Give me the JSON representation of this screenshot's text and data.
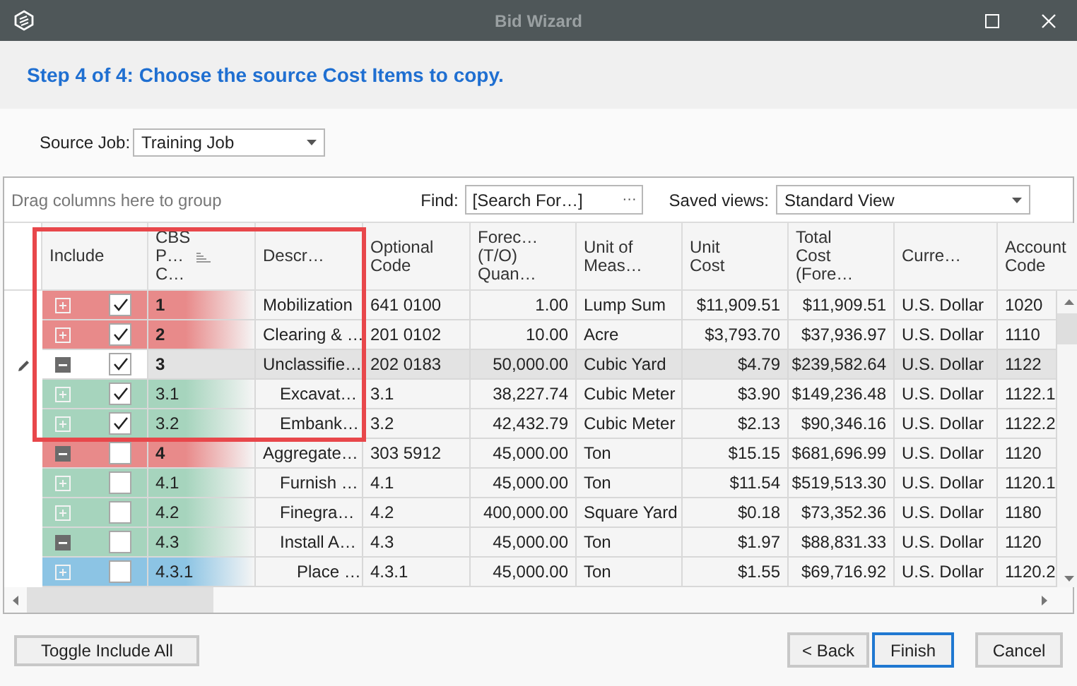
{
  "window": {
    "title": "Bid Wizard"
  },
  "step_title": "Step 4 of 4: Choose the source Cost Items to copy.",
  "source_job": {
    "label": "Source Job:",
    "value": "Training Job"
  },
  "group_panel": {
    "placeholder": "Drag columns here to group"
  },
  "find": {
    "label": "Find:",
    "placeholder": "[Search For…]",
    "button": "···"
  },
  "saved_views": {
    "label": "Saved views:",
    "value": "Standard View"
  },
  "columns": [
    {
      "label": "Include",
      "sorted": false
    },
    {
      "label": "CBS\nP…\nC…",
      "sorted": true
    },
    {
      "label": "Descr…",
      "sorted": false
    },
    {
      "label": "Optional\nCode",
      "sorted": false
    },
    {
      "label": "Forec…\n(T/O)\nQuan…",
      "sorted": false
    },
    {
      "label": "Unit of\nMeas…",
      "sorted": false
    },
    {
      "label": "Unit\nCost",
      "sorted": false
    },
    {
      "label": "Total\nCost\n(Fore…",
      "sorted": false
    },
    {
      "label": "Curre…",
      "sorted": false
    },
    {
      "label": "Account\nCode",
      "sorted": false
    }
  ],
  "rows": [
    {
      "cbs": "1",
      "description": "Mobilization",
      "optional_code": "641 0100",
      "quantity": "1.00",
      "unit": "Lump Sum",
      "unit_cost": "$11,909.51",
      "total_cost": "$11,909.51",
      "currency": "U.S. Dollar",
      "account_code": "1020",
      "included": true,
      "expanded": false,
      "selected": false,
      "color": "#e88a8a"
    },
    {
      "cbs": "2",
      "description": "Clearing & …",
      "optional_code": "201 0102",
      "quantity": "10.00",
      "unit": "Acre",
      "unit_cost": "$3,793.70",
      "total_cost": "$37,936.97",
      "currency": "U.S. Dollar",
      "account_code": "1110",
      "included": true,
      "expanded": false,
      "selected": false,
      "color": "#e88a8a"
    },
    {
      "cbs": "3",
      "description": "Unclassifie…",
      "optional_code": "202 0183",
      "quantity": "50,000.00",
      "unit": "Cubic Yard",
      "unit_cost": "$4.79",
      "total_cost": "$239,582.64",
      "currency": "U.S. Dollar",
      "account_code": "1122",
      "included": true,
      "expanded": true,
      "selected": true,
      "children": [
        {
          "cbs": "3.1",
          "description": "Excavat…",
          "optional_code": "3.1",
          "quantity": "38,227.74",
          "unit": "Cubic Meter",
          "unit_cost": "$3.90",
          "total_cost": "$149,236.48",
          "currency": "U.S. Dollar",
          "account_code": "1122.1",
          "included": true,
          "expanded": false,
          "selected": false,
          "color": "#a6d4bd"
        },
        {
          "cbs": "3.2",
          "description": "Embank…",
          "optional_code": "3.2",
          "quantity": "42,432.79",
          "unit": "Cubic Meter",
          "unit_cost": "$2.13",
          "total_cost": "$90,346.16",
          "currency": "U.S. Dollar",
          "account_code": "1122.2",
          "included": true,
          "expanded": false,
          "selected": false,
          "color": "#a6d4bd"
        }
      ]
    },
    {
      "cbs": "4",
      "description": "Aggregate…",
      "optional_code": "303 5912",
      "quantity": "45,000.00",
      "unit": "Ton",
      "unit_cost": "$15.15",
      "total_cost": "$681,696.99",
      "currency": "U.S. Dollar",
      "account_code": "1120",
      "included": false,
      "expanded": true,
      "selected": false,
      "color": "#e88a8a",
      "children": [
        {
          "cbs": "4.1",
          "description": "Furnish …",
          "optional_code": "4.1",
          "quantity": "45,000.00",
          "unit": "Ton",
          "unit_cost": "$11.54",
          "total_cost": "$519,513.30",
          "currency": "U.S. Dollar",
          "account_code": "1120.1",
          "included": false,
          "expanded": false,
          "selected": false,
          "color": "#a6d4bd"
        },
        {
          "cbs": "4.2",
          "description": "Finegra…",
          "optional_code": "4.2",
          "quantity": "400,000.00",
          "unit": "Square Yard",
          "unit_cost": "$0.18",
          "total_cost": "$73,352.36",
          "currency": "U.S. Dollar",
          "account_code": "1180",
          "included": false,
          "expanded": false,
          "selected": false,
          "color": "#a6d4bd"
        },
        {
          "cbs": "4.3",
          "description": "Install A…",
          "optional_code": "4.3",
          "quantity": "45,000.00",
          "unit": "Ton",
          "unit_cost": "$1.97",
          "total_cost": "$88,831.33",
          "currency": "U.S. Dollar",
          "account_code": "1120",
          "included": false,
          "expanded": true,
          "selected": false,
          "color": "#a6d4bd",
          "children": [
            {
              "cbs": "4.3.1",
              "description": "Place …",
              "optional_code": "4.3.1",
              "quantity": "45,000.00",
              "unit": "Ton",
              "unit_cost": "$1.55",
              "total_cost": "$69,716.92",
              "currency": "U.S. Dollar",
              "account_code": "1120.2",
              "included": false,
              "expanded": false,
              "selected": false,
              "color": "#8cc4e4"
            }
          ]
        }
      ]
    }
  ],
  "buttons": {
    "toggle": "Toggle Include All",
    "back": "< Back",
    "finish": "Finish",
    "cancel": "Cancel"
  }
}
